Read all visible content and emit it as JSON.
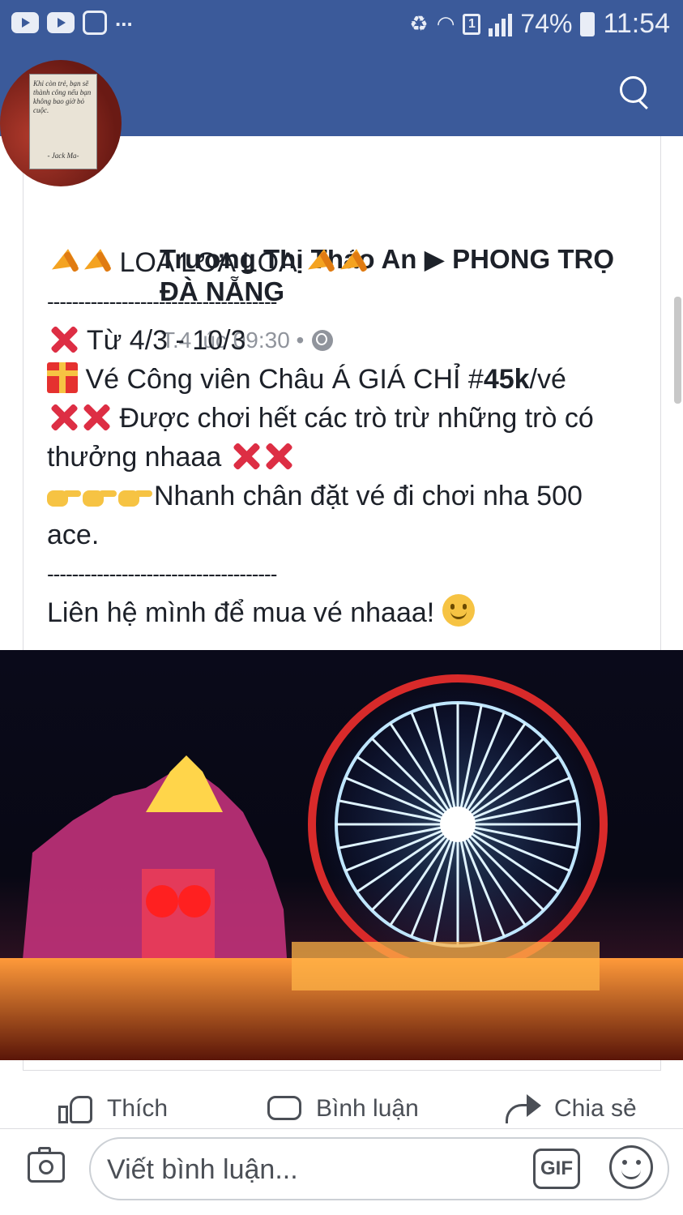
{
  "status_bar": {
    "more": "...",
    "sim_badge": "1",
    "battery": "74%",
    "time": "11:54"
  },
  "post": {
    "author_line1": "Trương Thị Thảo An ▶ PHÒNG TRỌ",
    "author_line2": "ĐÀ NẴNG",
    "timestamp": "T.4 lúc 09:30 •",
    "avatar_quote": "Khi còn trẻ, bạn sẽ thành công nếu bạn không bao giờ bỏ cuộc.",
    "avatar_attr": "- Jack Ma-",
    "headline": " LOA LOA LOA ",
    "divider": "-------------------------------------",
    "line_dates": " Từ 4/3 - 10/3",
    "line_ticket_a": " Vé Công viên Châu Á GIÁ CHỈ #",
    "line_ticket_bold": "45k",
    "line_ticket_b": "/vé",
    "line_rides": " Được chơi hết các trò trừ những trò có thưởng nhaaa ",
    "line_hurry": "Nhanh chân đặt vé đi chơi nha 500 ace.",
    "line_contact": "Liên hệ mình để mua vé nhaaa! "
  },
  "actions": {
    "like": "Thích",
    "comment": "Bình luận",
    "share": "Chia sẻ"
  },
  "composer": {
    "placeholder": "Viết bình luận...",
    "gif": "GIF"
  },
  "colors": {
    "brand": "#3b5a9a",
    "text": "#1d2129",
    "muted": "#90949c"
  }
}
